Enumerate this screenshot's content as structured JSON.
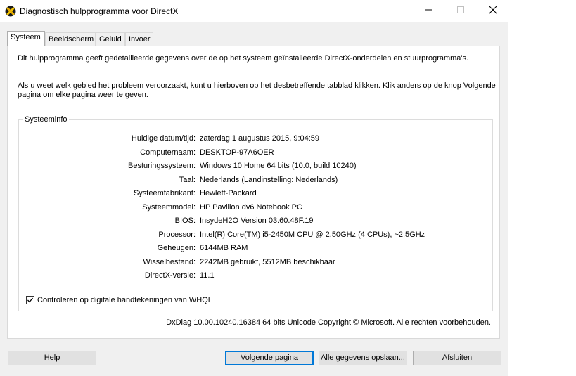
{
  "window": {
    "title": "Diagnostisch hulpprogramma voor DirectX",
    "icon": "directx-icon",
    "controls": {
      "minimize": "minimize-icon",
      "maximize": "maximize-icon",
      "close": "close-icon"
    }
  },
  "tabs": [
    {
      "label": "Systeem",
      "active": true
    },
    {
      "label": "Beeldscherm",
      "active": false
    },
    {
      "label": "Geluid",
      "active": false
    },
    {
      "label": "Invoer",
      "active": false
    }
  ],
  "intro": {
    "line1": "Dit hulpprogramma geeft gedetailleerde gegevens over de op het systeem geïnstalleerde DirectX-onderdelen en stuurprogramma's.",
    "line2": "Als u weet welk gebied het probleem veroorzaakt, kunt u hierboven op het desbetreffende tabblad klikken. Klik anders op de knop Volgende pagina om elke pagina weer te geven."
  },
  "system_info": {
    "title": "Systeeminfo",
    "rows": [
      {
        "label": "Huidige datum/tijd:",
        "value": "zaterdag 1 augustus 2015, 9:04:59"
      },
      {
        "label": "Computernaam:",
        "value": "DESKTOP-97A6OER"
      },
      {
        "label": "Besturingssysteem:",
        "value": "Windows 10 Home 64 bits (10.0, build 10240)"
      },
      {
        "label": "Taal:",
        "value": "Nederlands (Landinstelling: Nederlands)"
      },
      {
        "label": "Systeemfabrikant:",
        "value": "Hewlett-Packard"
      },
      {
        "label": "Systeemmodel:",
        "value": "HP Pavilion dv6 Notebook PC"
      },
      {
        "label": "BIOS:",
        "value": "InsydeH2O Version 03.60.48F.19"
      },
      {
        "label": "Processor:",
        "value": "Intel(R) Core(TM) i5-2450M CPU @ 2.50GHz (4 CPUs), ~2.5GHz"
      },
      {
        "label": "Geheugen:",
        "value": "6144MB RAM"
      },
      {
        "label": "Wisselbestand:",
        "value": "2242MB gebruikt, 5512MB beschikbaar"
      },
      {
        "label": "DirectX-versie:",
        "value": "11.1"
      }
    ],
    "whql_checkbox": {
      "label": "Controleren op digitale handtekeningen van WHQL",
      "checked": true
    }
  },
  "footer": "DxDiag 10.00.10240.16384 64 bits Unicode  Copyright © Microsoft.  Alle rechten voorbehouden.",
  "buttons": {
    "help": "Help",
    "next": "Volgende pagina",
    "save": "Alle gegevens opslaan...",
    "close": "Afsluiten"
  },
  "colors": {
    "accent": "#0078d7",
    "window_bg": "#f0f0f0",
    "panel_bg": "#ffffff"
  }
}
